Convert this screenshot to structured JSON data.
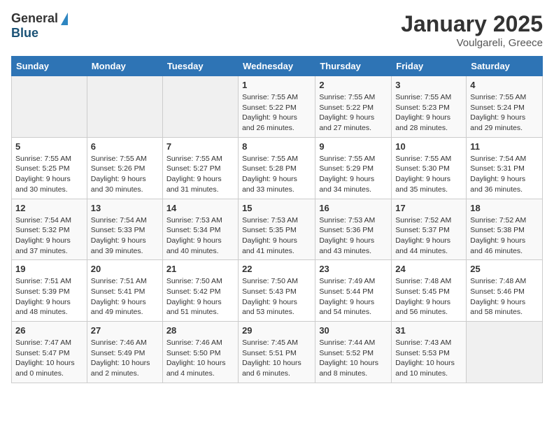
{
  "header": {
    "logo_general": "General",
    "logo_blue": "Blue",
    "month_title": "January 2025",
    "subtitle": "Voulgareli, Greece"
  },
  "weekdays": [
    "Sunday",
    "Monday",
    "Tuesday",
    "Wednesday",
    "Thursday",
    "Friday",
    "Saturday"
  ],
  "weeks": [
    [
      {
        "day": "",
        "info": ""
      },
      {
        "day": "",
        "info": ""
      },
      {
        "day": "",
        "info": ""
      },
      {
        "day": "1",
        "info": "Sunrise: 7:55 AM\nSunset: 5:22 PM\nDaylight: 9 hours\nand 26 minutes."
      },
      {
        "day": "2",
        "info": "Sunrise: 7:55 AM\nSunset: 5:22 PM\nDaylight: 9 hours\nand 27 minutes."
      },
      {
        "day": "3",
        "info": "Sunrise: 7:55 AM\nSunset: 5:23 PM\nDaylight: 9 hours\nand 28 minutes."
      },
      {
        "day": "4",
        "info": "Sunrise: 7:55 AM\nSunset: 5:24 PM\nDaylight: 9 hours\nand 29 minutes."
      }
    ],
    [
      {
        "day": "5",
        "info": "Sunrise: 7:55 AM\nSunset: 5:25 PM\nDaylight: 9 hours\nand 30 minutes."
      },
      {
        "day": "6",
        "info": "Sunrise: 7:55 AM\nSunset: 5:26 PM\nDaylight: 9 hours\nand 30 minutes."
      },
      {
        "day": "7",
        "info": "Sunrise: 7:55 AM\nSunset: 5:27 PM\nDaylight: 9 hours\nand 31 minutes."
      },
      {
        "day": "8",
        "info": "Sunrise: 7:55 AM\nSunset: 5:28 PM\nDaylight: 9 hours\nand 33 minutes."
      },
      {
        "day": "9",
        "info": "Sunrise: 7:55 AM\nSunset: 5:29 PM\nDaylight: 9 hours\nand 34 minutes."
      },
      {
        "day": "10",
        "info": "Sunrise: 7:55 AM\nSunset: 5:30 PM\nDaylight: 9 hours\nand 35 minutes."
      },
      {
        "day": "11",
        "info": "Sunrise: 7:54 AM\nSunset: 5:31 PM\nDaylight: 9 hours\nand 36 minutes."
      }
    ],
    [
      {
        "day": "12",
        "info": "Sunrise: 7:54 AM\nSunset: 5:32 PM\nDaylight: 9 hours\nand 37 minutes."
      },
      {
        "day": "13",
        "info": "Sunrise: 7:54 AM\nSunset: 5:33 PM\nDaylight: 9 hours\nand 39 minutes."
      },
      {
        "day": "14",
        "info": "Sunrise: 7:53 AM\nSunset: 5:34 PM\nDaylight: 9 hours\nand 40 minutes."
      },
      {
        "day": "15",
        "info": "Sunrise: 7:53 AM\nSunset: 5:35 PM\nDaylight: 9 hours\nand 41 minutes."
      },
      {
        "day": "16",
        "info": "Sunrise: 7:53 AM\nSunset: 5:36 PM\nDaylight: 9 hours\nand 43 minutes."
      },
      {
        "day": "17",
        "info": "Sunrise: 7:52 AM\nSunset: 5:37 PM\nDaylight: 9 hours\nand 44 minutes."
      },
      {
        "day": "18",
        "info": "Sunrise: 7:52 AM\nSunset: 5:38 PM\nDaylight: 9 hours\nand 46 minutes."
      }
    ],
    [
      {
        "day": "19",
        "info": "Sunrise: 7:51 AM\nSunset: 5:39 PM\nDaylight: 9 hours\nand 48 minutes."
      },
      {
        "day": "20",
        "info": "Sunrise: 7:51 AM\nSunset: 5:41 PM\nDaylight: 9 hours\nand 49 minutes."
      },
      {
        "day": "21",
        "info": "Sunrise: 7:50 AM\nSunset: 5:42 PM\nDaylight: 9 hours\nand 51 minutes."
      },
      {
        "day": "22",
        "info": "Sunrise: 7:50 AM\nSunset: 5:43 PM\nDaylight: 9 hours\nand 53 minutes."
      },
      {
        "day": "23",
        "info": "Sunrise: 7:49 AM\nSunset: 5:44 PM\nDaylight: 9 hours\nand 54 minutes."
      },
      {
        "day": "24",
        "info": "Sunrise: 7:48 AM\nSunset: 5:45 PM\nDaylight: 9 hours\nand 56 minutes."
      },
      {
        "day": "25",
        "info": "Sunrise: 7:48 AM\nSunset: 5:46 PM\nDaylight: 9 hours\nand 58 minutes."
      }
    ],
    [
      {
        "day": "26",
        "info": "Sunrise: 7:47 AM\nSunset: 5:47 PM\nDaylight: 10 hours\nand 0 minutes."
      },
      {
        "day": "27",
        "info": "Sunrise: 7:46 AM\nSunset: 5:49 PM\nDaylight: 10 hours\nand 2 minutes."
      },
      {
        "day": "28",
        "info": "Sunrise: 7:46 AM\nSunset: 5:50 PM\nDaylight: 10 hours\nand 4 minutes."
      },
      {
        "day": "29",
        "info": "Sunrise: 7:45 AM\nSunset: 5:51 PM\nDaylight: 10 hours\nand 6 minutes."
      },
      {
        "day": "30",
        "info": "Sunrise: 7:44 AM\nSunset: 5:52 PM\nDaylight: 10 hours\nand 8 minutes."
      },
      {
        "day": "31",
        "info": "Sunrise: 7:43 AM\nSunset: 5:53 PM\nDaylight: 10 hours\nand 10 minutes."
      },
      {
        "day": "",
        "info": ""
      }
    ]
  ]
}
